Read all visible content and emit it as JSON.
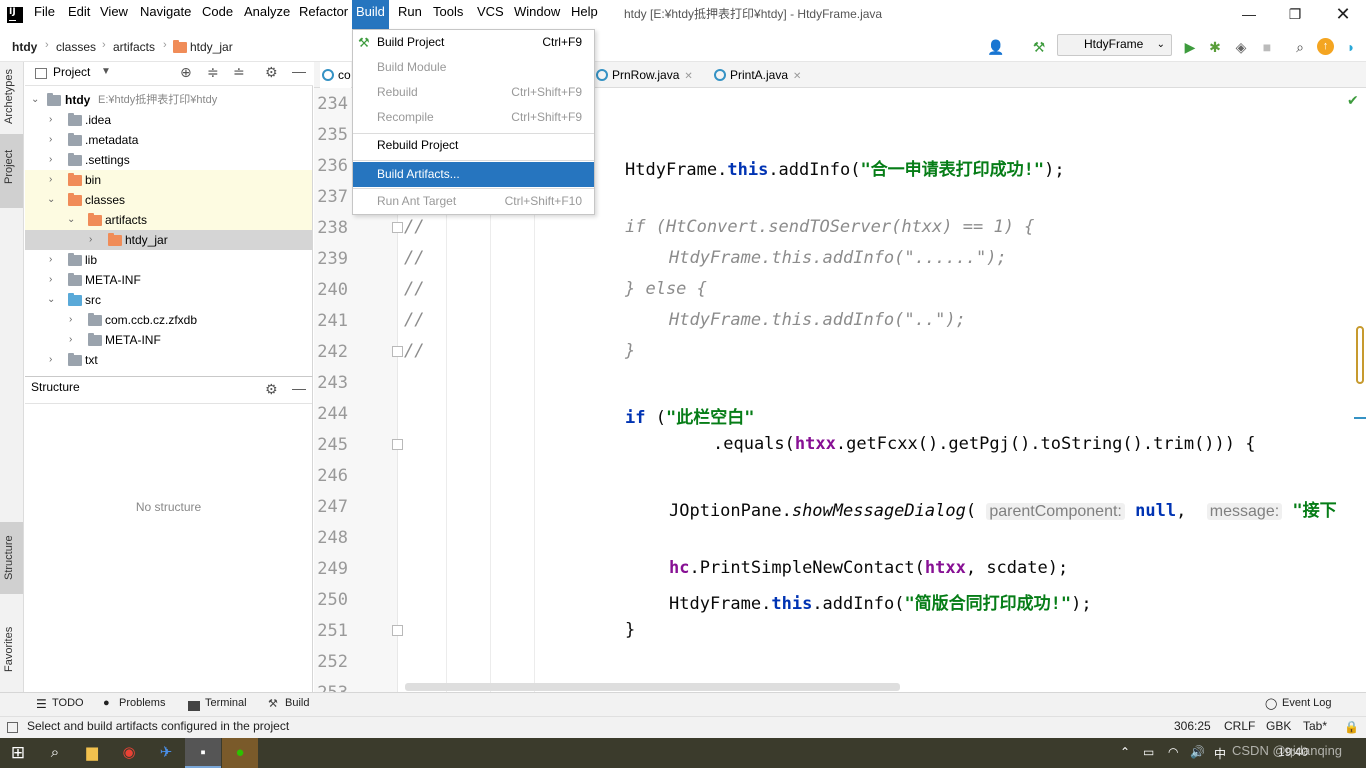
{
  "menu": {
    "items": [
      "File",
      "Edit",
      "View",
      "Navigate",
      "Code",
      "Analyze",
      "Refactor",
      "Build",
      "Run",
      "Tools",
      "VCS",
      "Window",
      "Help"
    ],
    "active": "Build"
  },
  "window_title": "htdy [E:¥htdy抵押表打印¥htdy] - HtdyFrame.java",
  "breadcrumb": [
    "htdy",
    "classes",
    "artifacts",
    "htdy_jar"
  ],
  "run_config": "HtdyFrame",
  "left_stripe": [
    "Archetypes",
    "Project",
    "Structure",
    "Favorites"
  ],
  "project_panel": {
    "title": "Project",
    "tree": [
      {
        "label": "htdy",
        "path": "E:¥htdy抵押表打印¥htdy"
      },
      {
        "label": ".idea"
      },
      {
        "label": ".metadata"
      },
      {
        "label": ".settings"
      },
      {
        "label": "bin"
      },
      {
        "label": "classes"
      },
      {
        "label": "artifacts"
      },
      {
        "label": "htdy_jar"
      },
      {
        "label": "lib"
      },
      {
        "label": "META-INF"
      },
      {
        "label": "src"
      },
      {
        "label": "com.ccb.cz.zfxdb"
      },
      {
        "label": "META-INF"
      },
      {
        "label": "txt"
      }
    ]
  },
  "structure_panel": {
    "title": "Structure",
    "empty_text": "No structure"
  },
  "editor_tabs": [
    "co",
    "PrnRow.java",
    "PrintA.java"
  ],
  "line_numbers": [
    "234",
    "235",
    "236",
    "237",
    "238",
    "239",
    "240",
    "241",
    "242",
    "243",
    "244",
    "245",
    "246",
    "247",
    "248",
    "249",
    "250",
    "251",
    "252",
    "253"
  ],
  "code": {
    "l236_obj": "HtdyFrame.",
    "l236_kw": "this",
    "l236_call": ".addInfo(",
    "l236_str": "\"合一申请表打印成功!\"",
    "l236_end": ");",
    "comment_marker": "//",
    "l238": "if (HtConvert.sendTOServer(htxx) == 1) {",
    "l239": "HtdyFrame.this.addInfo(\"......\");",
    "l240": "} else {",
    "l241": "HtdyFrame.this.addInfo(\"..\");",
    "l242": "}",
    "l244_kw": "if",
    "l244_open": " (",
    "l244_str": "\"此栏空白\"",
    "l245_a": ".equals(",
    "l245_fld": "htxx",
    "l245_b": ".getFcxx().getPgj().toString().trim())) {",
    "l247_a": "JOptionPane.",
    "l247_m": "showMessageDialog",
    "l247_b": "(",
    "l247_hint1": "parentComponent:",
    "l247_null": "null",
    "l247_comma": ",",
    "l247_hint2": "message:",
    "l247_str": "\"接下",
    "l249_fld": "hc",
    "l249_a": ".PrintSimpleNewContact(",
    "l249_fld2": "htxx",
    "l249_b": ", scdate);",
    "l250_a": "HtdyFrame.",
    "l250_kw": "this",
    "l250_b": ".addInfo(",
    "l250_str": "\"简版合同打印成功!\"",
    "l250_end": ");",
    "l251": "}"
  },
  "build_menu": [
    {
      "label": "Build Project",
      "shortcut": "Ctrl+F9",
      "enabled": true
    },
    {
      "label": "Build Module",
      "shortcut": "",
      "enabled": false
    },
    {
      "label": "Rebuild",
      "shortcut": "Ctrl+Shift+F9",
      "enabled": false
    },
    {
      "label": "Recompile",
      "shortcut": "Ctrl+Shift+F9",
      "enabled": false
    },
    {
      "label": "Rebuild Project",
      "shortcut": "",
      "enabled": true
    },
    {
      "label": "Build Artifacts...",
      "shortcut": "",
      "enabled": true,
      "highlighted": true
    },
    {
      "label": "Run Ant Target",
      "shortcut": "Ctrl+Shift+F10",
      "enabled": false
    }
  ],
  "bottom_tabs": [
    "TODO",
    "Problems",
    "Terminal",
    "Build"
  ],
  "event_log": "Event Log",
  "status": {
    "message": "Select and build artifacts configured in the project",
    "position": "306:25",
    "line_sep": "CRLF",
    "encoding": "GBK",
    "indent": "Tab*"
  },
  "taskbar": {
    "ime": "中",
    "clock": "19:40",
    "watermark": "CSDN @qidanqing"
  },
  "colors": {
    "accent": "#2675bf",
    "keyword": "#0033b3",
    "string": "#067d17",
    "field": "#871094",
    "comment": "#8c8c8c"
  }
}
